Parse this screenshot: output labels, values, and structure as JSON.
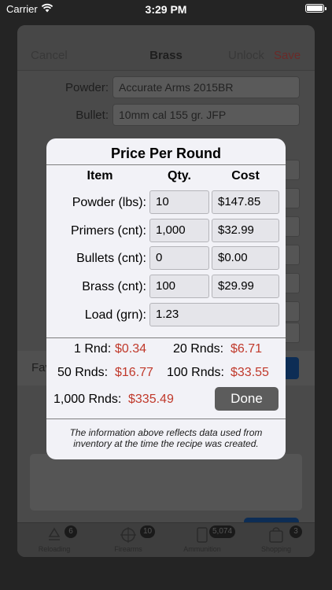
{
  "status": {
    "carrier": "Carrier",
    "time": "3:29 PM"
  },
  "nav": {
    "cancel": "Cancel",
    "title": "Brass",
    "unlock": "Unlock",
    "save": "Save"
  },
  "background_form": {
    "powder_label": "Powder:",
    "powder_value": "Accurate Arms 2015BR",
    "bullet_label": "Bullet:",
    "bullet_value": "10mm cal 155 gr. JFP",
    "favorite_label": "Fav"
  },
  "tabs": [
    {
      "label": "Reloading",
      "badge": "6"
    },
    {
      "label": "Firearms",
      "badge": "10"
    },
    {
      "label": "Ammunition",
      "badge": "5,074"
    },
    {
      "label": "Shopping",
      "badge": "3"
    }
  ],
  "modal": {
    "title": "Price Per Round",
    "headers": {
      "item": "Item",
      "qty": "Qty.",
      "cost": "Cost"
    },
    "rows": [
      {
        "label": "Powder (lbs):",
        "qty": "10",
        "cost": "$147.85"
      },
      {
        "label": "Primers (cnt):",
        "qty": "1,000",
        "cost": "$32.99"
      },
      {
        "label": "Bullets (cnt):",
        "qty": "0",
        "cost": "$0.00"
      },
      {
        "label": "Brass (cnt):",
        "qty": "100",
        "cost": "$29.99"
      }
    ],
    "load": {
      "label": "Load (grn):",
      "value": "1.23"
    },
    "results": {
      "r1_label": "1 Rnd:",
      "r1_value": "$0.34",
      "r20_label": "20 Rnds:",
      "r20_value": "$6.71",
      "r50_label": "50 Rnds:",
      "r50_value": "$16.77",
      "r100_label": "100 Rnds:",
      "r100_value": "$33.55",
      "r1000_label": "1,000 Rnds:",
      "r1000_value": "$335.49"
    },
    "done_label": "Done",
    "note": "The information above reflects data used from inventory at the time the recipe was created."
  },
  "colors": {
    "accent_red": "#c0392b",
    "done_bg": "#5c5c5c",
    "modal_bg": "#f2f2f7"
  }
}
